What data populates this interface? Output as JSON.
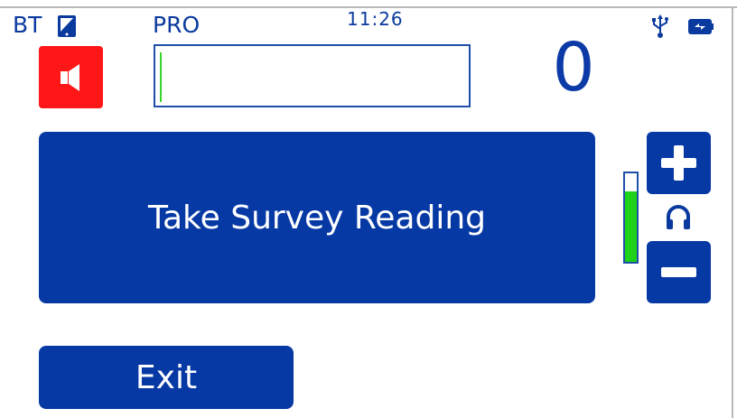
{
  "status_bar": {
    "bt_label": "BT",
    "mode_label": "PRO",
    "time": "11:26",
    "icons": [
      "tablet-icon",
      "usb-icon",
      "battery-charging-icon"
    ]
  },
  "speaker": {
    "icon": "speaker-icon",
    "state": "on",
    "color": "#ff1616"
  },
  "reading_input": {
    "value": "",
    "cursor_color": "#35d52b"
  },
  "count": {
    "value": "0"
  },
  "main_action": {
    "label": "Take Survey Reading"
  },
  "volume": {
    "level_fraction": 0.8,
    "increase_icon": "plus-icon",
    "decrease_icon": "minus-icon",
    "output_icon": "headphones-icon",
    "fill_color": "#1ed21a"
  },
  "exit": {
    "label": "Exit"
  },
  "colors": {
    "primary": "#0739a4",
    "text_blue": "#0c3aa6",
    "alert_red": "#ff1616",
    "meter_green": "#1ed21a"
  }
}
